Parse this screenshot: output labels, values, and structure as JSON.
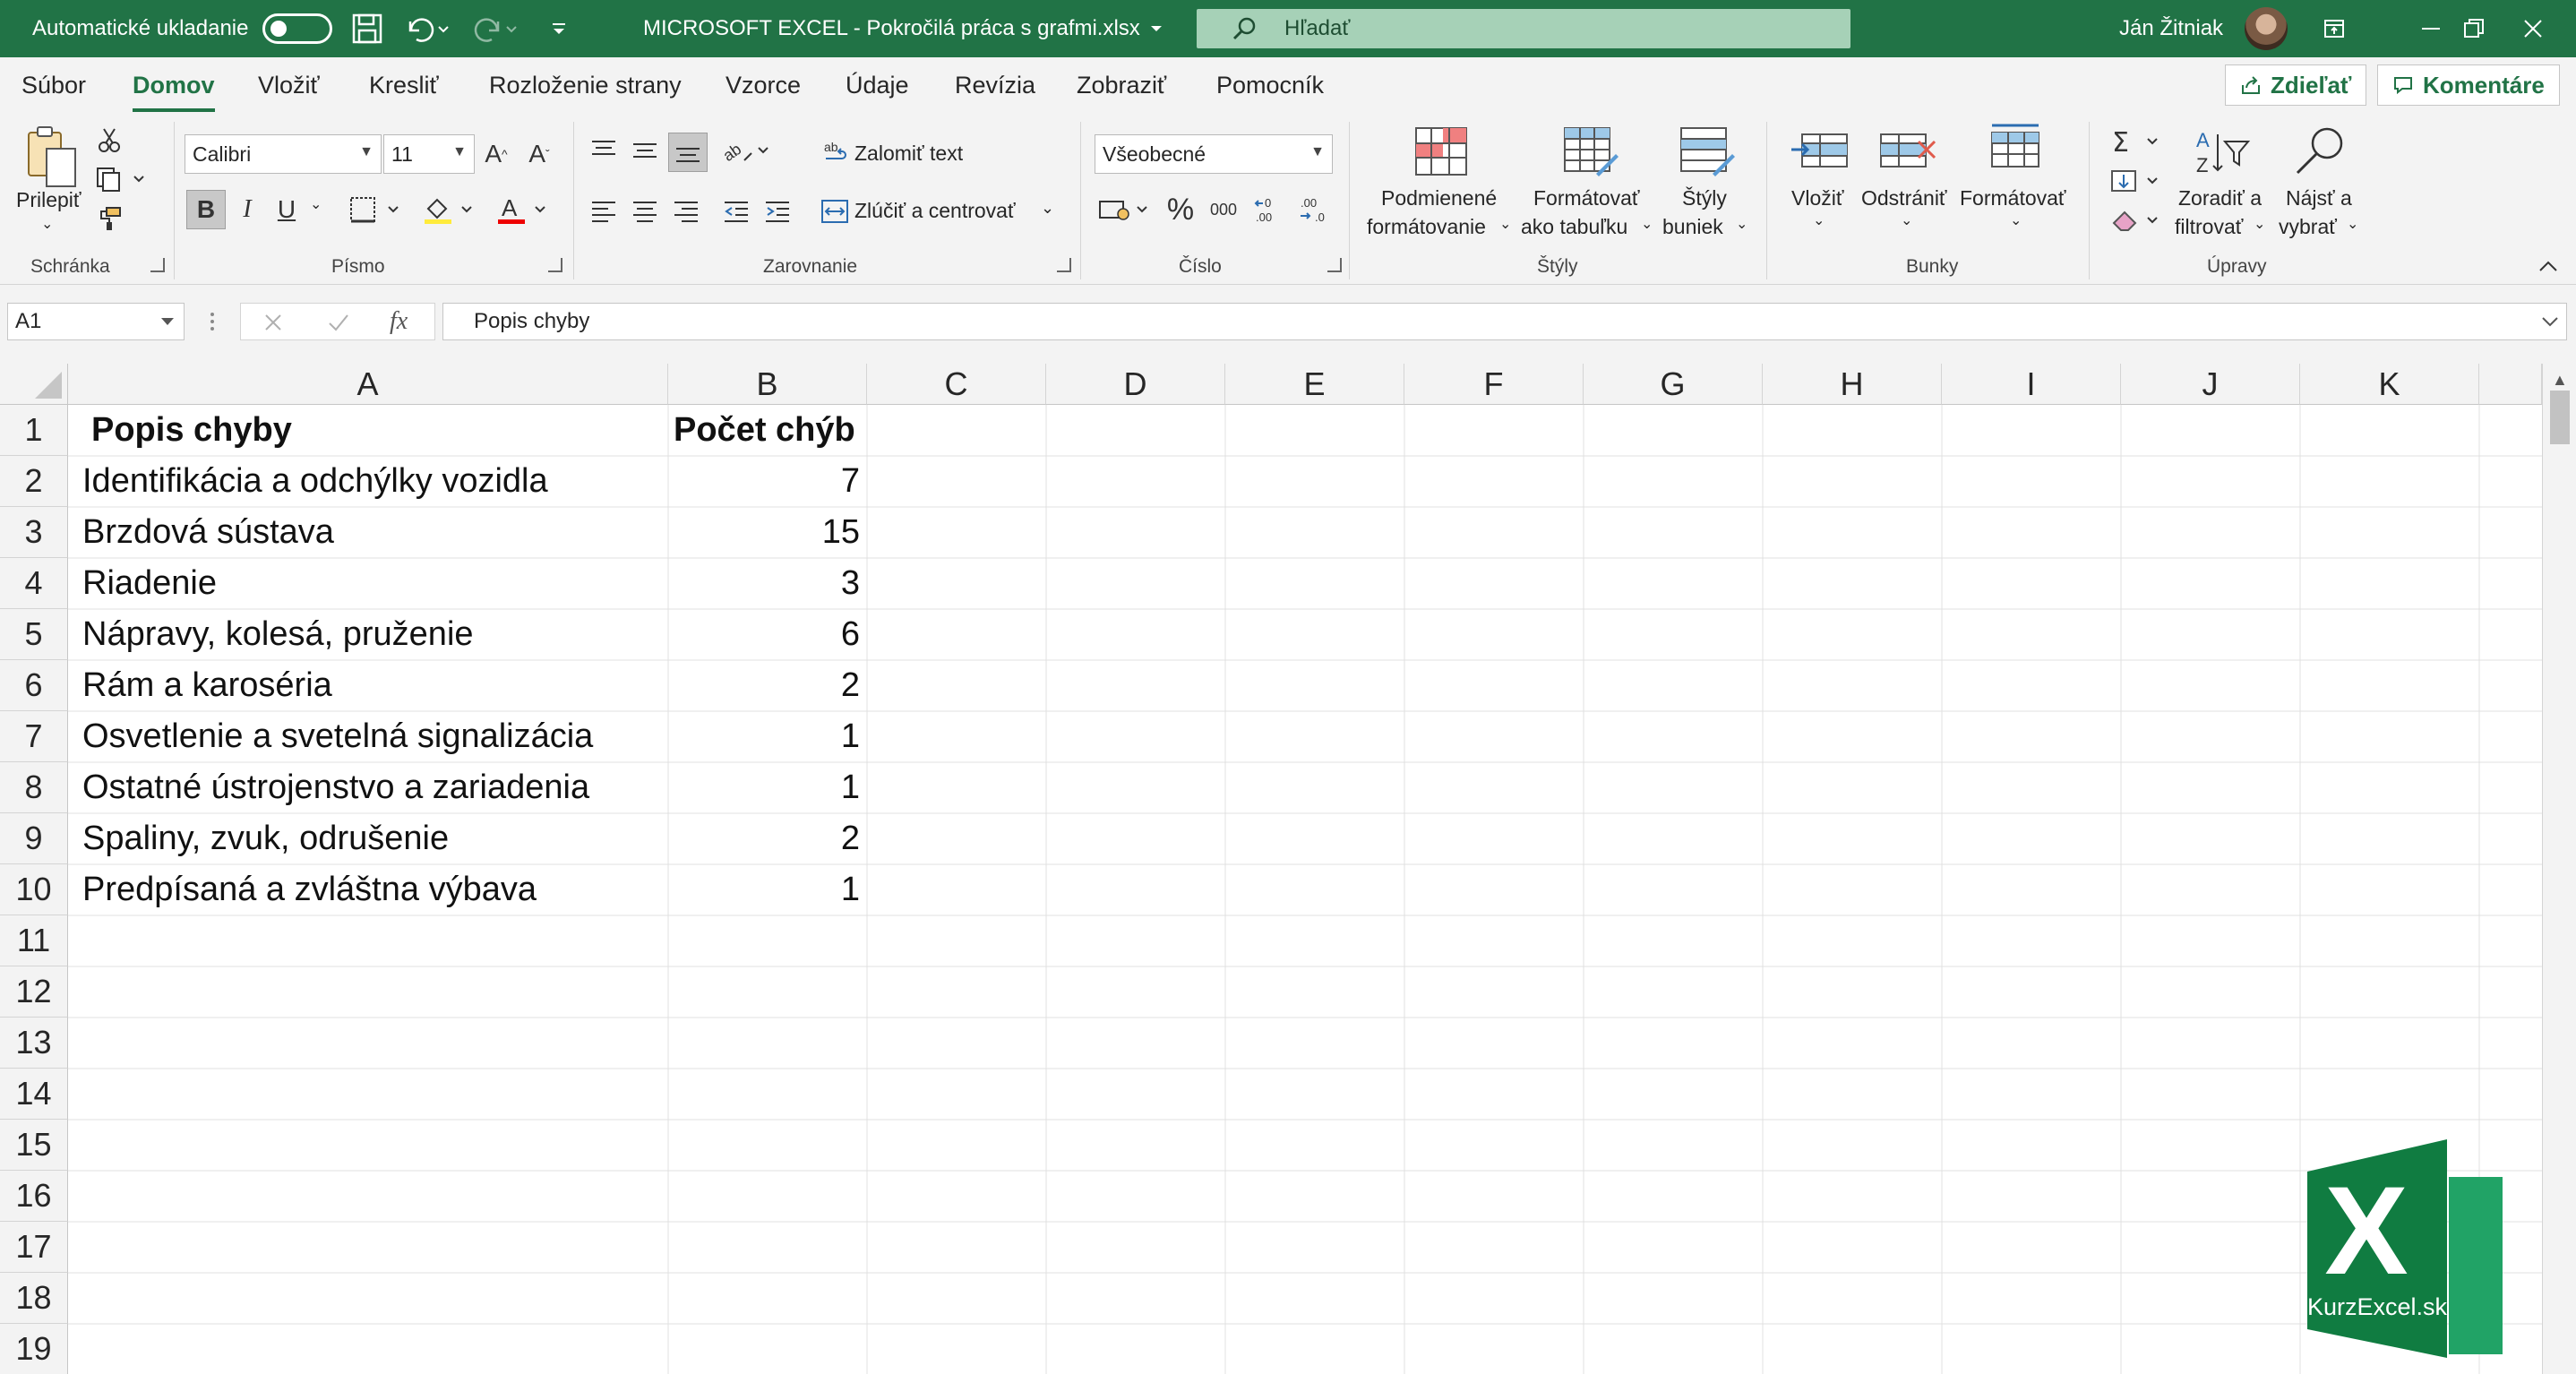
{
  "titlebar": {
    "autosave_label": "Automatické ukladanie",
    "doc_title": "MICROSOFT EXCEL - Pokročilá práca s grafmi.xlsx",
    "search_placeholder": "Hľadať",
    "user_name": "Ján Žitniak"
  },
  "menu": {
    "tabs": [
      "Súbor",
      "Domov",
      "Vložiť",
      "Kresliť",
      "Rozloženie strany",
      "Vzorce",
      "Údaje",
      "Revízia",
      "Zobraziť",
      "Pomocník"
    ],
    "active_tab": "Domov",
    "share_label": "Zdieľať",
    "comments_label": "Komentáre"
  },
  "ribbon": {
    "clipboard": {
      "paste_label": "Prilepiť",
      "group_label": "Schránka"
    },
    "font": {
      "font_name": "Calibri",
      "font_size": "11",
      "bold": "B",
      "italic": "I",
      "underline": "U",
      "group_label": "Písmo"
    },
    "alignment": {
      "wrap_text": "Zalomiť text",
      "merge_center": "Zlúčiť a centrovať",
      "group_label": "Zarovnanie"
    },
    "number": {
      "format": "Všeobecné",
      "group_label": "Číslo"
    },
    "styles": {
      "conditional_line1": "Podmienené",
      "conditional_line2": "formátovanie",
      "format_table_line1": "Formátovať",
      "format_table_line2": "ako tabuľku",
      "cell_styles_line1": "Štýly",
      "cell_styles_line2": "buniek",
      "group_label": "Štýly"
    },
    "cells": {
      "insert": "Vložiť",
      "delete": "Odstrániť",
      "format": "Formátovať",
      "group_label": "Bunky"
    },
    "editing": {
      "sort_line1": "Zoradiť a",
      "sort_line2": "filtrovať",
      "find_line1": "Nájsť a",
      "find_line2": "vybrať",
      "group_label": "Úpravy"
    }
  },
  "formula_bar": {
    "name_box": "A1",
    "fx": "fx",
    "formula": "Popis chyby"
  },
  "sheet": {
    "columns": [
      "A",
      "B",
      "C",
      "D",
      "E",
      "F",
      "G",
      "H",
      "I",
      "J",
      "K"
    ],
    "rows": [
      "1",
      "2",
      "3",
      "4",
      "5",
      "6",
      "7",
      "8",
      "9",
      "10",
      "11",
      "12",
      "13",
      "14",
      "15",
      "16",
      "17",
      "18",
      "19"
    ],
    "header": {
      "a": "Popis chyby",
      "b": "Počet chýb"
    },
    "data": [
      {
        "a": "Identifikácia a odchýlky vozidla",
        "b": "7"
      },
      {
        "a": "Brzdová sústava",
        "b": "15"
      },
      {
        "a": "Riadenie",
        "b": "3"
      },
      {
        "a": "Nápravy, kolesá, pruženie",
        "b": "6"
      },
      {
        "a": "Rám a karoséria",
        "b": "2"
      },
      {
        "a": "Osvetlenie a svetelná signalizácia",
        "b": "1"
      },
      {
        "a": "Ostatné ústrojenstvo a zariadenia",
        "b": "1"
      },
      {
        "a": "Spaliny, zvuk, odrušenie",
        "b": "2"
      },
      {
        "a": "Predpísaná a zvláštna výbava",
        "b": "1"
      }
    ]
  },
  "logo": {
    "letter": "X",
    "text": "KurzExcel.sk"
  },
  "colors": {
    "accent": "#217346",
    "search_bg": "#a6d1b7"
  }
}
